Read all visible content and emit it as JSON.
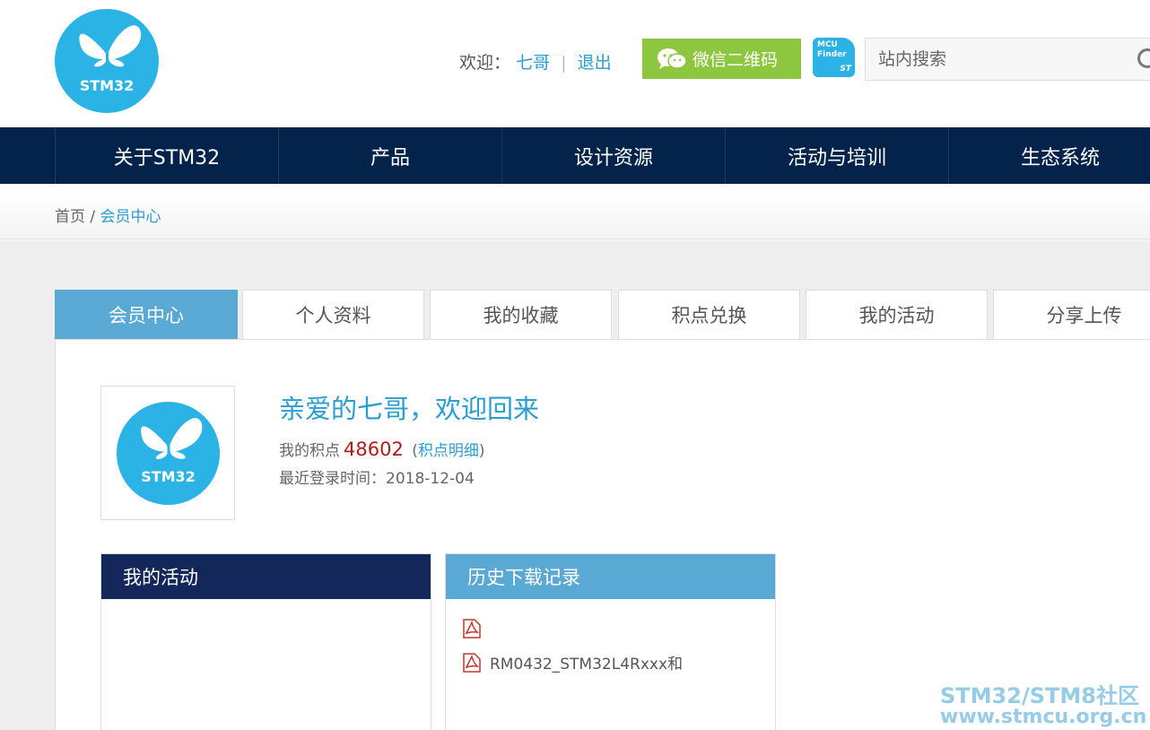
{
  "header": {
    "logo_text": "STM32",
    "welcome_label": "欢迎：",
    "username": "七哥",
    "divider": "|",
    "logout": "退出",
    "wechat_button": "微信二维码",
    "mcu_finder_line1": "MCU",
    "mcu_finder_line2": "Finder",
    "mcu_finder_brand": "ST",
    "search_placeholder": "站内搜索"
  },
  "nav": {
    "items": [
      {
        "label": "关于STM32"
      },
      {
        "label": "产品"
      },
      {
        "label": "设计资源"
      },
      {
        "label": "活动与培训"
      },
      {
        "label": "生态系统"
      }
    ]
  },
  "breadcrumb": {
    "home": "首页",
    "separator": "/",
    "current": "会员中心"
  },
  "tabs": [
    {
      "label": "会员中心",
      "active": true
    },
    {
      "label": "个人资料"
    },
    {
      "label": "我的收藏"
    },
    {
      "label": "积点兑换"
    },
    {
      "label": "我的活动"
    },
    {
      "label": "分享上传"
    }
  ],
  "profile": {
    "avatar_text": "STM32",
    "greeting": "亲爱的七哥，欢迎回来",
    "points_label": "我的积点",
    "points_value": "48602",
    "points_detail_open": "(",
    "points_detail": "积点明细",
    "points_detail_close": ")",
    "last_login_label": "最近登录时间：",
    "last_login_value": "2018-12-04"
  },
  "activity_box": {
    "title": "我的活动"
  },
  "history_box": {
    "title": "历史下载记录",
    "items": [
      {
        "name": ""
      },
      {
        "name": "RM0432_STM32L4Rxxx和"
      }
    ]
  },
  "watermark": {
    "line1": "STM32/STM8社区",
    "line2": "www.stmcu.org.cn"
  },
  "colors": {
    "nav_bg": "#03234b",
    "accent": "#2a9dd1",
    "tab_active": "#5aa8d4",
    "activity_head": "#14275a",
    "wechat_green": "#8dc63f",
    "points_red": "#b31b1b"
  }
}
